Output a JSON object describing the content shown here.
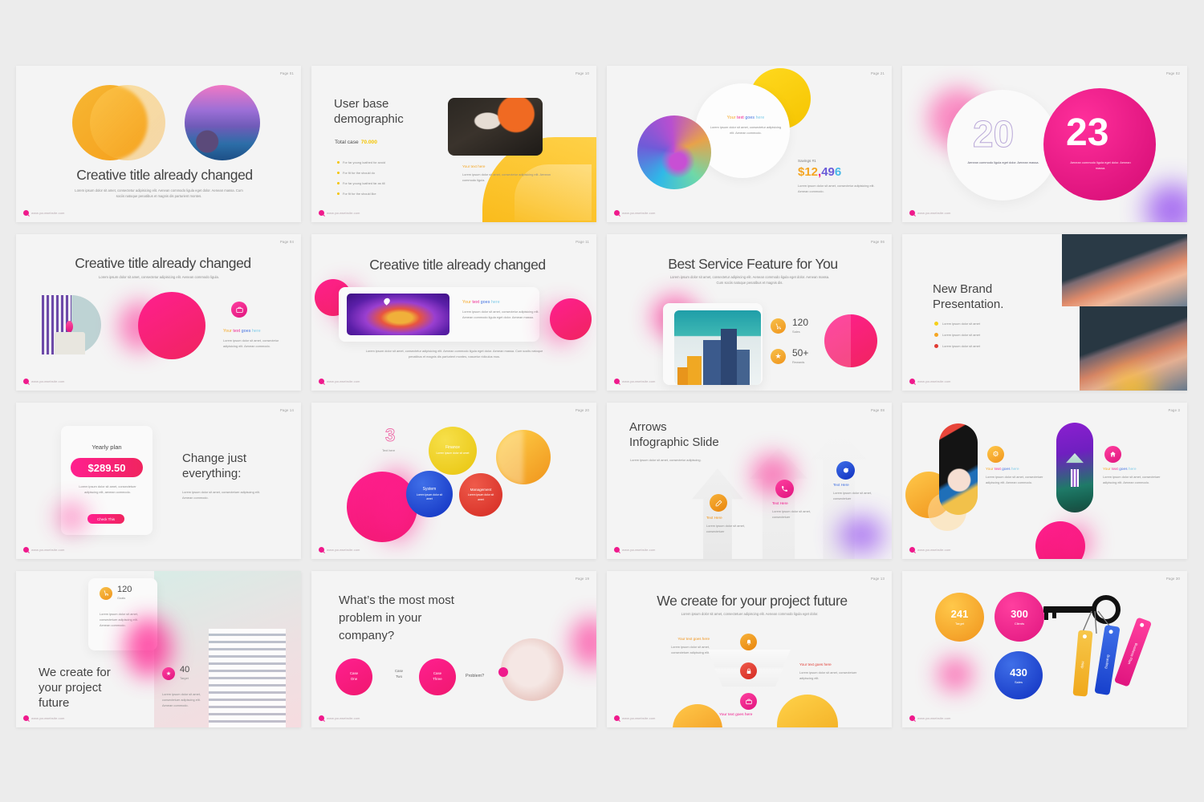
{
  "deck": {
    "background": "#ececec",
    "slide_bg": "#f4f4f4",
    "accents": {
      "pink": "#ef1a8c",
      "orange": "#f5a623",
      "blue": "#3f6fe0",
      "yellow": "#f5d019",
      "red": "#e03b33",
      "purple": "#8b3df0"
    },
    "footer_url": "www.yourwebsite.com"
  },
  "slides": [
    {
      "id": 1,
      "page": "Page 01",
      "title": "Creative title already changed",
      "body": "Lorem ipsum dolor sit amet, consectetur adipisicing elit. Aenean commodo ligula eget dolor. Aenean massa. Cum sociis natoque penatibus et magnis dis parturient montes."
    },
    {
      "id": 2,
      "page": "Page 10",
      "title_line1": "User base",
      "title_line2": "demographic",
      "total_label": "Total case",
      "total_value": "70.000",
      "bullets": [
        "For far young loathed for avoid",
        "For fit for the should do",
        "For far young loathed far as till",
        "For fit for the should like"
      ],
      "card_heading": "Your text here",
      "card_body": "Lorem ipsum dolor sit amet, consectetur adipisicing elit. Aenean commodo ligula."
    },
    {
      "id": 3,
      "page": "Page 21",
      "circle_heading": "Your text goes here",
      "circle_body": "Lorem ipsum dolor sit amet, consectetur adipisicing elit. Aenean commodo.",
      "savings_label": "Savings #1",
      "savings_value": "$12,496",
      "savings_parts": [
        "$12",
        ",",
        "49",
        "6"
      ],
      "savings_body": "Lorem ipsum dolor sit amet, consectetur adipisicing elit. Aenean commodo."
    },
    {
      "id": 4,
      "page": "Page 02",
      "year_left": "20",
      "year_right": "23",
      "left_body": "Aenean commodo ligula eget dolor. Aenean massa.",
      "right_body": "Aenean commodo ligula eget dolor. Aenean massa."
    },
    {
      "id": 5,
      "page": "Page 04",
      "title": "Creative title already changed",
      "sub": "Lorem ipsum dolor sit amet, consectetur adipisicing elit. Aenean commodo ligula.",
      "icon": "briefcase-icon",
      "heading": "Your text goes here",
      "body": "Lorem ipsum dolor sit amet, consectetur adipisicing elit. Aenean commodo."
    },
    {
      "id": 6,
      "page": "Page 11",
      "title": "Creative title already changed",
      "heading": "Your text goes here",
      "body": "Lorem ipsum dolor sit amet, consectetur adipisicing elit. Aenean commodo ligula eget dolor. Aenean massa.",
      "footer_body": "Lorem ipsum dolor sit amet, consectetur adipisicing elit. Aenean commodo ligula eget dolor. Aenean massa. Cum sociis natoque penatibus et magnis dis parturient montes, nascetur ridiculus mus."
    },
    {
      "id": 7,
      "page": "Page 06",
      "title": "Best Service Feature for You",
      "sub": "Lorem ipsum dolor sit amet, consectetur adipiscing elit. Aenean commodo ligula eget dolor. Aenean massa. Cum sociis natoque penatibus et magnis dis.",
      "stats": [
        {
          "icon": "cart-icon",
          "value": "120",
          "label": "Sales"
        },
        {
          "icon": "star-icon",
          "value": "50+",
          "label": "Rewards"
        }
      ]
    },
    {
      "id": 8,
      "page": "Page 05",
      "title_line1": "New Brand",
      "title_line2": "Presentation.",
      "bullets": [
        {
          "color": "#f5d019",
          "text": "Lorem ipsum dolor sit amet"
        },
        {
          "color": "#f5a623",
          "text": "Lorem ipsum dolor sit amet"
        },
        {
          "color": "#e03b33",
          "text": "Lorem ipsum dolor sit amet"
        }
      ]
    },
    {
      "id": 9,
      "page": "Page 14",
      "plan_label": "Yearly plan",
      "price": "$289.50",
      "plan_body": "Lorem ipsum dolor sit amet, consectetuer adipiscing elit, aenean commodo.",
      "cta": "Check This",
      "title_line1": "Change just",
      "title_line2": "everything:",
      "body": "Lorem ipsum dolor sit amet, consectetuer adipiscing elit. Aenean commodo."
    },
    {
      "id": 10,
      "page": "Page 20",
      "number": "3",
      "number_label": "Text here",
      "bubbles": [
        {
          "color": "#f5d019",
          "title": "Finance",
          "body": "Lorem ipsum dolor sit amet"
        },
        {
          "color": "#1e49d4",
          "title": "System",
          "body": "Lorem ipsum dolor sit amet"
        },
        {
          "color": "#e03b33",
          "title": "Management",
          "body": "Lorem ipsum dolor sit amet"
        }
      ]
    },
    {
      "id": 11,
      "page": "Page 08",
      "title_line1": "Arrows",
      "title_line2": "Infographic Slide",
      "sub": "Lorem ipsum dolor sit amet, consectetur adipiscing.",
      "columns": [
        {
          "color": "#f0941c",
          "icon": "pencil-icon",
          "title": "Text Here",
          "body": "Lorem ipsum dolor sit amet, consectetuer"
        },
        {
          "color": "#ef1a8c",
          "icon": "phone-icon",
          "title": "Text Here",
          "body": "Lorem ipsum dolor sit amet, consectetuer"
        },
        {
          "color": "#1e49d4",
          "icon": "chat-icon",
          "title": "Text Here",
          "body": "Lorem ipsum dolor sit amet, consectetuer"
        }
      ]
    },
    {
      "id": 12,
      "page": "Page 3",
      "items": [
        {
          "icon": "gear-icon",
          "icon_color": "#f5a623",
          "heading": "Your text goes here",
          "body": "Lorem ipsum dolor sit amet, consectetuer adipiscing elit. Aenean commodo."
        },
        {
          "icon": "home-icon",
          "icon_color": "#ef1a8c",
          "heading": "Your text goes here",
          "body": "Lorem ipsum dolor sit amet, consectetuer adipiscing elit. Aenean commodo."
        }
      ]
    },
    {
      "id": 13,
      "page": "Page 07",
      "title_line1": "We create for",
      "title_line2": "your project",
      "title_line3": "future",
      "cards": [
        {
          "icon": "cart-icon",
          "icon_color": "#f5a623",
          "value": "120",
          "label": "Goals",
          "body": "Lorem ipsum dolor sit amet, consectetuer adipiscing elit. Aenean commodo."
        },
        {
          "icon": "star-icon",
          "icon_color": "#ef1a8c",
          "value": "40",
          "label": "Target",
          "body": "Lorem ipsum dolor sit amet, consectetuer adipiscing elit. Aenean commodo."
        }
      ]
    },
    {
      "id": 14,
      "page": "Page 19",
      "title_line1": "What’s the most most",
      "title_line2": "problem in your",
      "title_line3": "company?",
      "cases": [
        {
          "type": "filled",
          "l1": "Case",
          "l2": "One"
        },
        {
          "type": "plain",
          "l1": "Case",
          "l2": "Two"
        },
        {
          "type": "filled",
          "l1": "Case",
          "l2": "Three"
        }
      ],
      "question": "Problem?"
    },
    {
      "id": 15,
      "page": "Page 13",
      "title": "We create for your project future",
      "sub": "Lorem ipsum dolor sit amet, consectetuer adipiscing elit. Aenean commodo ligula eget dolor.",
      "steps": [
        {
          "icon": "bell-icon",
          "color": "#f0941c",
          "heading": "Your text goes here",
          "body": "Lorem ipsum dolor sit amet, consectetuer adipiscing elit.",
          "side": "left"
        },
        {
          "icon": "lock-icon",
          "color": "#e03b33",
          "heading": "Your text goes here",
          "body": "Lorem ipsum dolor sit amet, consectetuer adipiscing elit.",
          "side": "right"
        },
        {
          "icon": "briefcase-icon",
          "color": "#ef1a8c",
          "heading": "Your text goes here",
          "body": "",
          "side": "center"
        }
      ]
    },
    {
      "id": 16,
      "page": "Page 30",
      "stats": [
        {
          "color": "#f5a623",
          "value": "241",
          "label": "Target"
        },
        {
          "color": "#ef1a8c",
          "value": "300",
          "label": "Clients"
        },
        {
          "color": "#1e49d4",
          "value": "430",
          "label": "Sales"
        }
      ],
      "tags": [
        {
          "color": "#f5b120",
          "text": "Help"
        },
        {
          "color": "#1e49d4",
          "text": "Branding"
        },
        {
          "color": "#ef1a8c",
          "text": "Business Plan"
        }
      ]
    }
  ]
}
